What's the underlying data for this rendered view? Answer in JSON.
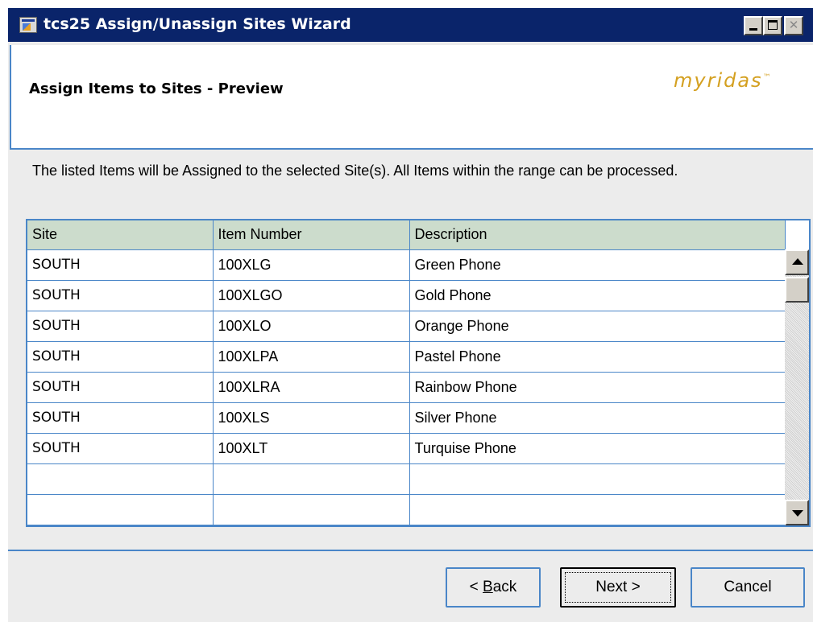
{
  "window": {
    "title": "tcs25 Assign/Unassign Sites Wizard",
    "icon": "app-window-icon"
  },
  "header": {
    "title": "Assign Items to Sites - Preview",
    "brand": "myridas",
    "brand_mark": "™"
  },
  "instruction": "The listed Items will be Assigned to the selected Site(s). All Items within the range can be processed.",
  "grid": {
    "columns": [
      "Site",
      "Item Number",
      "Description"
    ],
    "rows": [
      {
        "site": "SOUTH",
        "item": "100XLG",
        "description": "Green Phone"
      },
      {
        "site": "SOUTH",
        "item": "100XLGO",
        "description": "Gold Phone"
      },
      {
        "site": "SOUTH",
        "item": "100XLO",
        "description": "Orange Phone"
      },
      {
        "site": "SOUTH",
        "item": "100XLPA",
        "description": "Pastel Phone"
      },
      {
        "site": "SOUTH",
        "item": "100XLRA",
        "description": "Rainbow Phone"
      },
      {
        "site": "SOUTH",
        "item": "100XLS",
        "description": "Silver Phone"
      },
      {
        "site": "SOUTH",
        "item": "100XLT",
        "description": "Turquise Phone"
      },
      {
        "site": "",
        "item": "",
        "description": ""
      },
      {
        "site": "",
        "item": "",
        "description": ""
      }
    ]
  },
  "buttons": {
    "back_prefix": "< ",
    "back_key": "B",
    "back_rest": "ack",
    "next": "Next >",
    "cancel": "Cancel"
  },
  "colors": {
    "titlebar": "#0a246a",
    "accent_border": "#4a86c8",
    "grid_header": "#ccdccc",
    "brand": "#d4a020"
  }
}
